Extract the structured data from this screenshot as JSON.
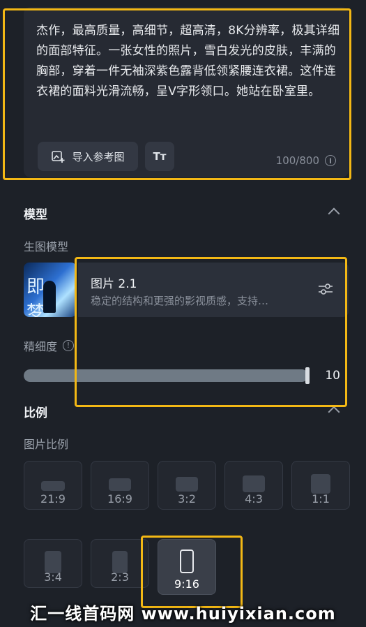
{
  "prompt": {
    "text": "杰作，最高质量，高细节，超高清，8K分辨率，极其详细的面部特征。一张女性的照片，雪白发光的皮肤，丰满的胸部，穿着一件无袖深紫色露背低领紧腰连衣裙。这件连衣裙的面料光滑流畅，呈V字形领口。她站在卧室里。",
    "import_label": "导入参考图",
    "text_icon": "Tт",
    "counter": "100/800",
    "info_glyph": "i"
  },
  "model_section": {
    "title": "模型",
    "sub_label": "生图模型",
    "thumb_text": "即梦",
    "model_name": "图片 2.1",
    "model_desc": "稳定的结构和更强的影视质感，支持…",
    "precision_label": "精细度",
    "precision_value": "10",
    "precision_fraction": 1.0
  },
  "ratio_section": {
    "title": "比例",
    "sub_label": "图片比例",
    "options": [
      {
        "label": "21:9",
        "selected": false
      },
      {
        "label": "16:9",
        "selected": false
      },
      {
        "label": "3:2",
        "selected": false
      },
      {
        "label": "4:3",
        "selected": false
      },
      {
        "label": "1:1",
        "selected": false
      },
      {
        "label": "3:4",
        "selected": false
      },
      {
        "label": "2:3",
        "selected": false
      },
      {
        "label": "9:16",
        "selected": true
      }
    ]
  },
  "watermark": "汇一线首码网 www.huiyixian.com",
  "colors": {
    "background": "#1d2128",
    "card": "#262a33",
    "highlight": "#f3b815"
  }
}
